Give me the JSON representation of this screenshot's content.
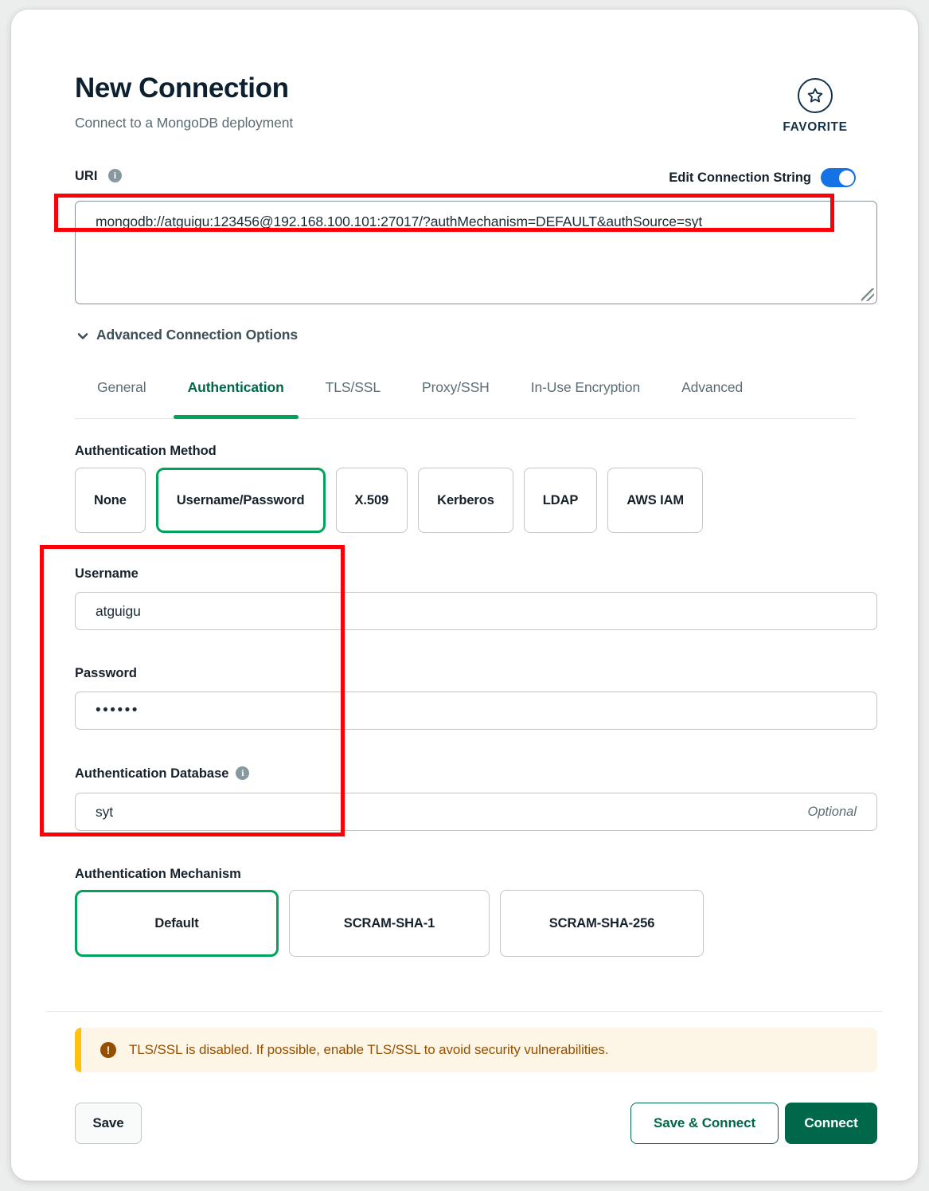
{
  "header": {
    "title": "New Connection",
    "subtitle": "Connect to a MongoDB deployment",
    "favorite_label": "FAVORITE"
  },
  "uri": {
    "label": "URI",
    "info_icon": "info-icon",
    "edit_connection_string_label": "Edit Connection String",
    "toggle_state": "on",
    "value": "mongodb://atguigu:123456@192.168.100.101:27017/?authMechanism=DEFAULT&authSource=syt"
  },
  "advanced": {
    "label": "Advanced Connection Options",
    "chevron_icon": "chevron-down-icon",
    "expanded": true
  },
  "tabs": [
    {
      "label": "General",
      "active": false
    },
    {
      "label": "Authentication",
      "active": true
    },
    {
      "label": "TLS/SSL",
      "active": false
    },
    {
      "label": "Proxy/SSH",
      "active": false
    },
    {
      "label": "In-Use Encryption",
      "active": false
    },
    {
      "label": "Advanced",
      "active": false
    }
  ],
  "auth_method": {
    "label": "Authentication Method",
    "options": [
      {
        "label": "None",
        "selected": false
      },
      {
        "label": "Username/Password",
        "selected": true
      },
      {
        "label": "X.509",
        "selected": false
      },
      {
        "label": "Kerberos",
        "selected": false
      },
      {
        "label": "LDAP",
        "selected": false
      },
      {
        "label": "AWS IAM",
        "selected": false
      }
    ]
  },
  "fields": {
    "username": {
      "label": "Username",
      "value": "atguigu"
    },
    "password": {
      "label": "Password",
      "value": "••••••"
    },
    "auth_database": {
      "label": "Authentication Database",
      "value": "syt",
      "hint": "Optional",
      "info_icon": "info-icon"
    }
  },
  "auth_mechanism": {
    "label": "Authentication Mechanism",
    "options": [
      {
        "label": "Default",
        "selected": true
      },
      {
        "label": "SCRAM-SHA-1",
        "selected": false
      },
      {
        "label": "SCRAM-SHA-256",
        "selected": false
      }
    ]
  },
  "warning": {
    "icon": "warning-icon",
    "text": "TLS/SSL is disabled. If possible, enable TLS/SSL to avoid security vulnerabilities."
  },
  "footer": {
    "save_label": "Save",
    "save_connect_label": "Save & Connect",
    "connect_label": "Connect"
  },
  "colors": {
    "brand_green": "#00a35c",
    "dark_green": "#00684a",
    "toggle_blue": "#1573e6",
    "warning_bg": "#fdf6e6",
    "warning_bar": "#ffc010",
    "warning_text": "#944f01",
    "annotation_red": "#fb0007"
  }
}
